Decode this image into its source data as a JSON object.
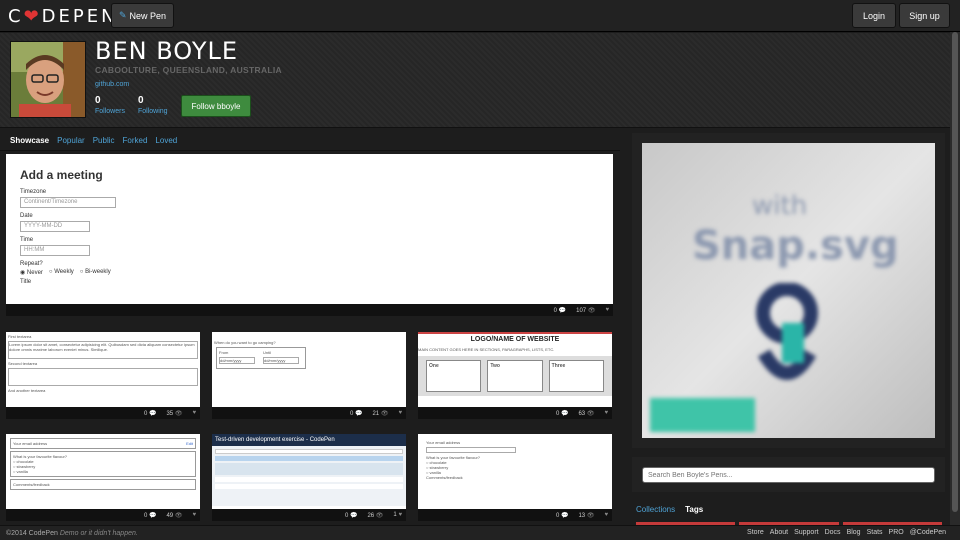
{
  "header": {
    "logo_left": "C",
    "logo_right": "DEPEN",
    "new_pen": "New Pen",
    "login": "Login",
    "signup": "Sign up"
  },
  "profile": {
    "name": "BEN BOYLE",
    "location": "CABOOLTURE, QUEENSLAND, AUSTRALIA",
    "link": "github.com",
    "followers_count": "0",
    "followers_label": "Followers",
    "following_count": "0",
    "following_label": "Following",
    "follow_button": "Follow bboyle"
  },
  "tabs": [
    "Showcase",
    "Popular",
    "Public",
    "Forked",
    "Loved"
  ],
  "featured": {
    "heading": "Add a meeting",
    "timezone_label": "Timezone",
    "timezone_placeholder": "Continent/Timezone",
    "date_label": "Date",
    "date_placeholder": "YYYY-MM-DD",
    "time_label": "Time",
    "time_placeholder": "HH:MM",
    "repeat_label": "Repeat?",
    "repeat_options": [
      "Never",
      "Weekly",
      "Bi-weekly"
    ],
    "title_label": "Title",
    "comments": "0",
    "views": "107"
  },
  "pens": [
    {
      "comments": "0",
      "views": "35",
      "t1": "First textarea",
      "t2": "Lorem ipsum dolor sit amet, consectetur adipisicing elit. Quibusdam sed dicta aliquam consectetur ipsum dolore omnis maxime laborum eveniet minus. Similique.",
      "t3": "Second textarea",
      "t4": "And another textarea"
    },
    {
      "comments": "0",
      "views": "21",
      "t1": "When do you want to go camping?",
      "t2": "From",
      "t3": "Until",
      "t4": "dd/mm/yyyy"
    },
    {
      "comments": "0",
      "views": "63",
      "t1": "LOGO/NAME OF WEBSITE",
      "t2": "MAIN CONTENT GOES HERE IN SECTIONS, PARAGRAPHS, LISTS, ETC.",
      "c1": "One",
      "c2": "Two",
      "c3": "Three"
    },
    {
      "comments": "0",
      "views": "49",
      "t1": "Your email address",
      "t2": "What is your favourite flavour?",
      "o1": "chocolate",
      "o2": "strawberry",
      "o3": "vanilla",
      "t3": "Comments/feedback",
      "edit": "Edit"
    },
    {
      "comments": "0",
      "views": "26",
      "loves": "1",
      "t1": "Test-driven development exercise - CodePen"
    },
    {
      "comments": "0",
      "views": "13",
      "t1": "Your email address",
      "t2": "What is your favourite flavour?",
      "o1": "chocolate",
      "o2": "strawberry",
      "o3": "vanilla",
      "t3": "Comments/feedback"
    }
  ],
  "sidebar": {
    "ad_line1": "with",
    "ad_line2": "Snap.svg",
    "search_placeholder": "Search Ben Boyle's Pens...",
    "collections": "Collections",
    "tags": "Tags"
  },
  "footer": {
    "copyright": "©2014 CodePen",
    "tagline": "Demo or it didn't happen.",
    "links": [
      "Store",
      "About",
      "Support",
      "Docs",
      "Blog",
      "Stats",
      "PRO",
      "@CodePen"
    ]
  },
  "colors": {
    "accent": "#4fa3d6",
    "follow": "#3e8b3e",
    "heart": "#e03434"
  }
}
